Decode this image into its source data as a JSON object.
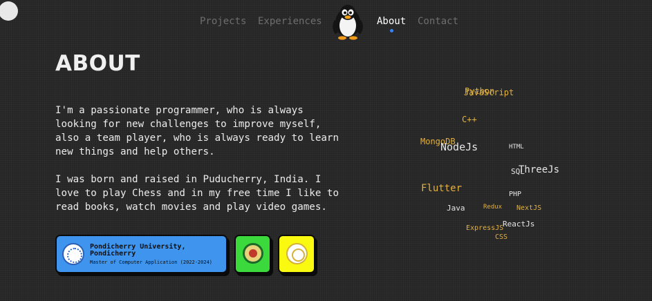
{
  "nav": {
    "links": [
      "Projects",
      "Experiences",
      "About",
      "Contact"
    ]
  },
  "about": {
    "title": "ABOUT",
    "paragraph1": [
      "I'm a passionate programmer, who is always",
      "looking for new challenges to improve myself,",
      "also a team player, who is always ready to learn",
      "new things and help others."
    ],
    "paragraph2": [
      "I was born and raised in Puducherry, India. I",
      "love to play Chess and in my free time I like to",
      "read books, watch movies and play video games."
    ]
  },
  "education": {
    "university": "Pondicherry University, Pondicherry",
    "degree": "Master of Computer Application (2022-2024)"
  },
  "skills": {
    "items": [
      "Python",
      "JavaScript",
      "C++",
      "MongoDB",
      "NodeJs",
      "HTML",
      "SQL",
      "ThreeJs",
      "Flutter",
      "PHP",
      "Java",
      "Redux",
      "NextJS",
      "ExpressJS",
      "ReactJs",
      "CSS"
    ],
    "colors": {
      "gold": "#e3b13e",
      "light": "#e6e6e6"
    }
  },
  "colors": {
    "background": "#262626",
    "accent": "#3b82f6",
    "card_blue": "#3f95ee",
    "card_green": "#3bd93b",
    "card_yellow": "#fafa10"
  }
}
